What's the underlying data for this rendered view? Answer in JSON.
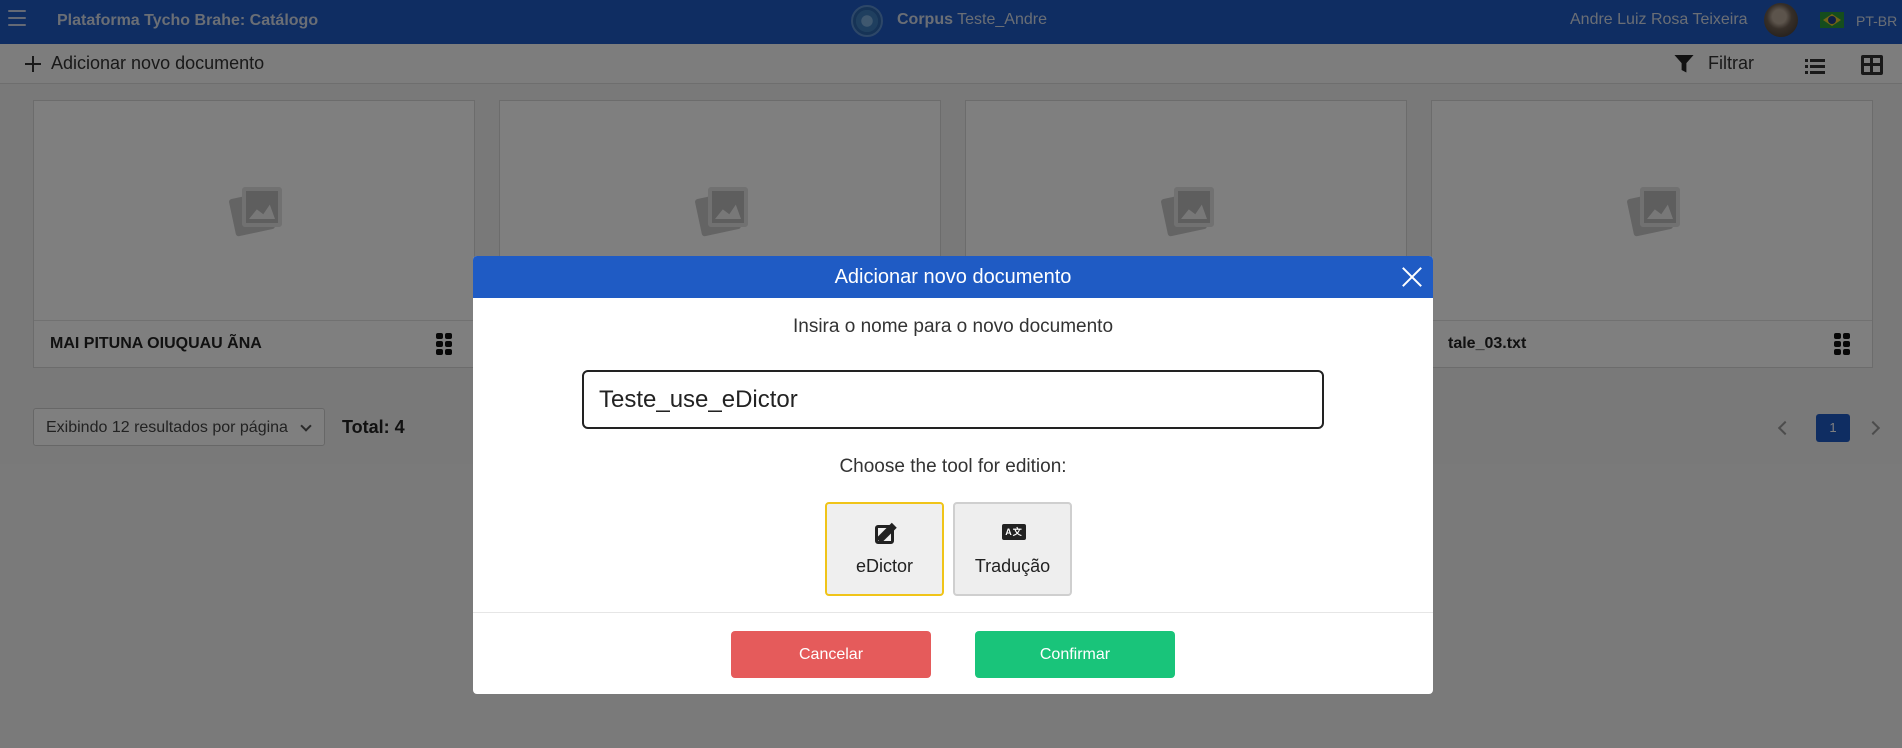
{
  "topbar": {
    "app_title": "Plataforma Tycho Brahe: Catálogo",
    "corpus_label": "Corpus",
    "corpus_name": "Teste_Andre",
    "user_name": "Andre Luiz Rosa Teixeira",
    "language": "PT-BR"
  },
  "toolbar": {
    "add_document": "Adicionar novo documento",
    "filter": "Filtrar"
  },
  "cards": [
    {
      "title": "MAI PITUNA OIUQUAU ÃNA"
    },
    {
      "title": ""
    },
    {
      "title": ""
    },
    {
      "title": "tale_03.txt"
    }
  ],
  "pagination": {
    "per_page": "Exibindo 12 resultados por página",
    "total": "Total: 4",
    "current_page": "1"
  },
  "modal": {
    "title": "Adicionar novo documento",
    "prompt": "Insira o nome para o novo documento",
    "input_value": "Teste_use_eDictor",
    "choose_tool": "Choose the tool for edition:",
    "tools": [
      {
        "label": "eDictor",
        "icon": "edit-icon",
        "selected": true
      },
      {
        "label": "Tradução",
        "icon": "translate-icon",
        "selected": false
      }
    ],
    "translate_icon_text": "A文",
    "cancel": "Cancelar",
    "confirm": "Confirmar"
  },
  "colors": {
    "brand_blue": "#1f5bc4",
    "cancel_red": "#e55b5b",
    "confirm_green": "#19c47a",
    "selected_border": "#f0c419"
  }
}
